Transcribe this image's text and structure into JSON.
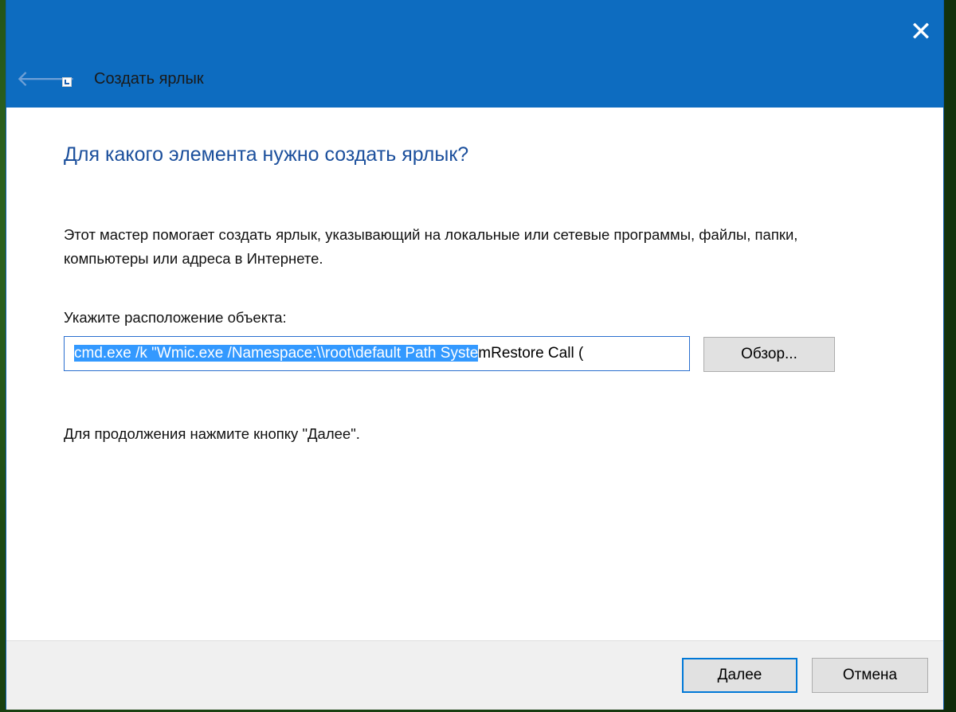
{
  "window": {
    "title": "Создать ярлык",
    "close_glyph": "✕",
    "back_glyph": "🡐"
  },
  "content": {
    "heading": "Для какого элемента нужно создать ярлык?",
    "description": "Этот мастер помогает создать ярлык, указывающий на локальные или сетевые программы, файлы, папки, компьютеры или адреса в Интернете.",
    "location_label": "Укажите расположение объекта:",
    "location_selected": "cmd.exe /k \"Wmic.exe /Namespace:\\\\root\\default Path Syste",
    "location_rest": "mRestore Call (",
    "browse_label": "Обзор...",
    "continue_hint": "Для продолжения нажмите кнопку \"Далее\"."
  },
  "footer": {
    "next_label": "Далее",
    "cancel_label": "Отмена"
  },
  "colors": {
    "titlebar": "#0d6cc0",
    "heading": "#1b4f9c",
    "selection": "#3399ff",
    "focus_border": "#0078d7"
  },
  "icons": {
    "back": "back-arrow-icon",
    "app": "shortcut-icon",
    "close": "close-icon"
  }
}
